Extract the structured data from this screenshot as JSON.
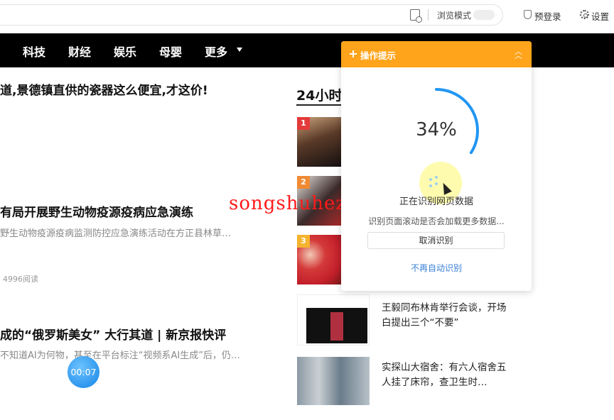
{
  "toolbar": {
    "browse_mode_label": "浏览模式",
    "login_label": "预登录",
    "settings_label": "设置"
  },
  "nav": {
    "items": [
      "科技",
      "财经",
      "娱乐",
      "母婴",
      "更多"
    ]
  },
  "articles": [
    {
      "title": "道,景德镇直供的瓷器这么便宜,才这价!"
    },
    {
      "title": "有局开展野生动物疫源疫病应急演练",
      "summary": "野生动物疫源疫病监测防控应急演练活动在方正县林草…",
      "reads": "4996阅读"
    },
    {
      "title": "成的“俄罗斯美女” 大行其道 | 新京报快评",
      "summary": "不知道AI为何物，甚至在平台标注“视频系AI生成”后，仍…"
    }
  ],
  "sidebar": {
    "heading": "24小时",
    "ranks": [
      "1",
      "2",
      "3"
    ],
    "news": [
      {
        "title": "王毅同布林肯举行会谈，开场白提出三个“不要”"
      },
      {
        "title": "实探山大宿舍：有六人宿舍五人挂了床帘，查卫生时…"
      }
    ]
  },
  "watermark": "songshuhezi.com",
  "panel": {
    "title": "操作提示",
    "progress": 0.34,
    "progress_label": "34%",
    "status": "正在识别网页数据",
    "substatus": "识别页面滚动是否会加载更多数据...",
    "cancel_label": "取消识别",
    "no_auto_label": "不再自动识别"
  },
  "timer": "00:07",
  "colors": {
    "panel_header": "#ffa41b",
    "progress_arc": "#2196f3",
    "link": "#3a7fd8",
    "watermark": "#ff1a1a"
  }
}
